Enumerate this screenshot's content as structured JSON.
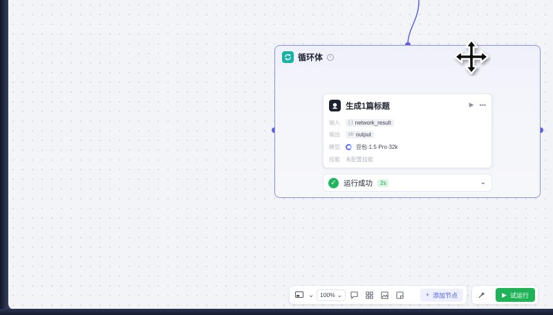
{
  "loop": {
    "title": "循环体",
    "info": "i"
  },
  "llm_node": {
    "title": "生成1篇标题",
    "input_label": "输入",
    "input_tag": "{ }",
    "input_value": "network_result",
    "output_label": "输出",
    "output_tag": "str",
    "output_value": "output",
    "model_label": "模型",
    "model_value": "豆包·1.5·Pro·32k",
    "skill_label": "技能",
    "skill_value": "未配置技能"
  },
  "status": {
    "text": "运行成功",
    "duration": "2s"
  },
  "toolbar": {
    "zoom": "100%",
    "add_node_label": "添加节点",
    "run_label": "试运行"
  },
  "colors": {
    "accent": "#5b5fe0",
    "loop_border": "#8a8fe8",
    "success": "#21b560",
    "run_button": "#1fb257"
  }
}
